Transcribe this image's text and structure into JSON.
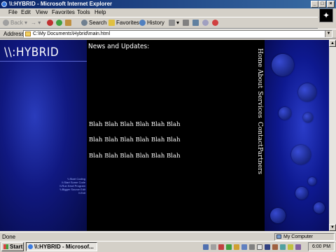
{
  "window": {
    "title": "\\\\:HYBRID - Microsoft Internet Explorer",
    "controls": {
      "minimize": "_",
      "maximize": "□",
      "close": "×"
    }
  },
  "menu": [
    "File",
    "Edit",
    "View",
    "Favorites",
    "Tools",
    "Help"
  ],
  "toolbar": {
    "back": "Back",
    "forward": "→",
    "search": "Search",
    "favorites": "Favorites",
    "history": "History"
  },
  "address": {
    "label": "Address",
    "url": "C:\\My Documents\\Hybrid\\main.html"
  },
  "page": {
    "logo": "\\\\:HYBRID",
    "news_title": "News and Updates:",
    "news_lines": [
      "Blah Blah Blah Blah Blah Blah",
      "Blah Blah Blah Blah Blah Blah",
      "Blah Blah Blah Blah Blah Blah"
    ],
    "nav": [
      "Home",
      "About",
      "Services",
      "Contact",
      "Partners"
    ],
    "side_links": [
      "\\\\:Start Coding",
      "\\\\:Start Some Code",
      "\\\\:Run Kewl Program",
      "\\\\:Bigger Source Edit",
      "\\\\:Exit"
    ]
  },
  "status": {
    "text": "Done",
    "zone": "My Computer"
  },
  "taskbar": {
    "start": "Start",
    "task": "\\\\:HYBRID - Microsof...",
    "clock": "6:00 PM"
  },
  "colors": {
    "titlebar": "#0a246a",
    "panel_blue": "#101880",
    "chrome": "#d4d0c8"
  }
}
